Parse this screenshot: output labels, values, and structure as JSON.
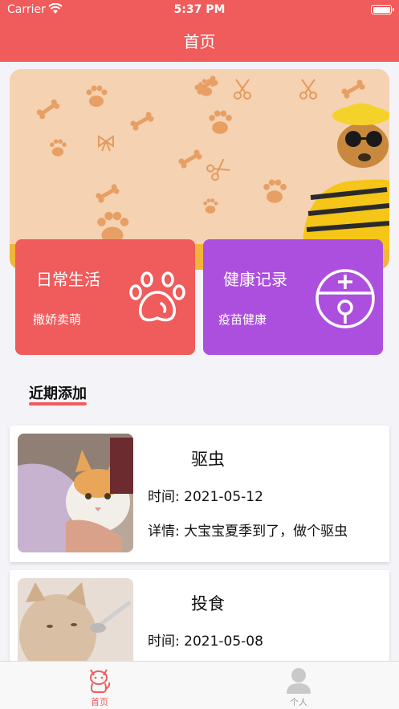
{
  "status_bar": {
    "carrier": "Carrier",
    "time": "5:37 PM"
  },
  "header": {
    "title": "首页"
  },
  "cards": [
    {
      "title": "日常生活",
      "subtitle": "撒娇卖萌",
      "icon": "paw-icon",
      "color": "#f05b5b"
    },
    {
      "title": "健康记录",
      "subtitle": "疫苗健康",
      "icon": "health-globe-icon",
      "color": "#ad4fde"
    }
  ],
  "section": {
    "title": "近期添加"
  },
  "records": [
    {
      "name": "驱虫",
      "time_label": "时间:",
      "time": "2021-05-12",
      "detail_label": "详情:",
      "detail": "大宝宝夏季到了，做个驱虫"
    },
    {
      "name": "投食",
      "time_label": "时间:",
      "time": "2021-05-08"
    }
  ],
  "tabbar": {
    "tabs": [
      {
        "label": "首页",
        "icon": "cat-icon",
        "active": true
      },
      {
        "label": "个人",
        "icon": "person-icon",
        "active": false
      }
    ]
  },
  "colors": {
    "accent": "#f05b5b",
    "purple": "#ad4fde",
    "banner_bg": "#f4d2b2"
  }
}
